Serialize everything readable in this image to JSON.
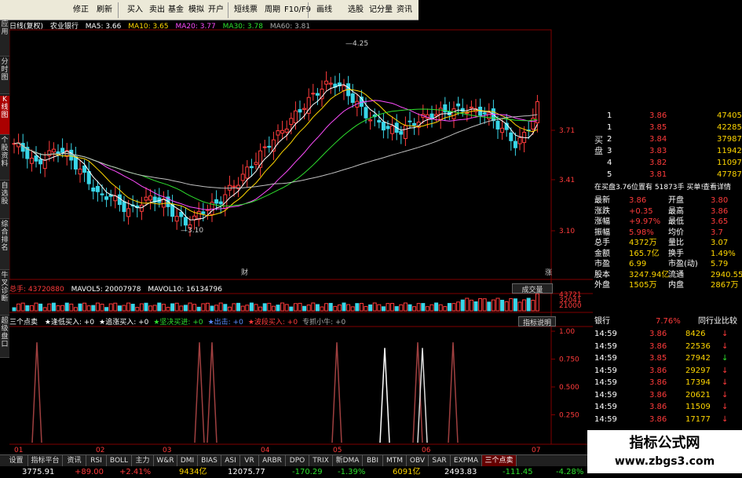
{
  "toolbar": {
    "items": [
      "修正",
      "刷新",
      "买入",
      "卖出",
      "基金",
      "模拟",
      "开户",
      "短线票",
      "周期",
      "F10/F9",
      "画线",
      "选股",
      "记分量",
      "资讯"
    ]
  },
  "left_tabs": [
    "应用",
    "分时图",
    "K线图",
    "个股资料",
    "自选股",
    "综合排名",
    "牛叉诊断",
    "超级盘口"
  ],
  "chart_legend": {
    "period": "日线(复权)",
    "stock": "农业银行",
    "ma5": "MA5: 3.66",
    "ma10": "MA10: 3.65",
    "ma20": "MA20: 3.77",
    "ma30": "MA30: 3.78",
    "ma60": "MA60: 3.81"
  },
  "volume_legend": {
    "total": "总手: 43720880",
    "mavol5": "MAVOL5: 20007978",
    "mavol10": "MAVOL10: 16134796",
    "button": "成交量"
  },
  "indicator_legend": {
    "name": "三个点卖",
    "items": [
      "★逢低买入: +0",
      "★追涨买入: +0",
      "★坚决买进: +0",
      "★出击: +0",
      "★波段买入: +0",
      "专抓小牛: +0"
    ],
    "button": "指标说明"
  },
  "annotations": {
    "high": "4.25",
    "low": "3.10",
    "cai": "财",
    "zhang": "涨"
  },
  "price_axis": [
    "3.71",
    "3.41",
    "3.10"
  ],
  "volume_axis": [
    "43721",
    "32041",
    "21000"
  ],
  "indicator_axis": [
    "1.00",
    "0.750",
    "0.500",
    "0.250"
  ],
  "x_axis": [
    "01",
    "02",
    "03",
    "04",
    "05",
    "06",
    "07"
  ],
  "orderbook": {
    "sell": [
      {
        "lv": "1",
        "price": "3.86",
        "vol": "47405"
      },
      {
        "lv": "1",
        "price": "3.85",
        "vol": "42285"
      },
      {
        "lv": "2",
        "price": "3.84",
        "vol": "37987"
      },
      {
        "lv": "3",
        "price": "3.83",
        "vol": "11942"
      },
      {
        "lv": "4",
        "price": "3.82",
        "vol": "11097"
      },
      {
        "lv": "5",
        "price": "3.81",
        "vol": "47787"
      }
    ],
    "buy_label": "买盘",
    "info": "在买盘3.76位置有 51873手 买单!",
    "info_link": "查看详情"
  },
  "quote": [
    [
      "最新",
      "3.86",
      "开盘",
      "3.80"
    ],
    [
      "涨跌",
      "+0.35",
      "最高",
      "3.86"
    ],
    [
      "涨幅",
      "+9.97%",
      "最低",
      "3.65"
    ],
    [
      "振幅",
      "5.98%",
      "均价",
      "3.7"
    ],
    [
      "总手",
      "4372万",
      "量比",
      "3.07"
    ],
    [
      "金额",
      "165.7亿",
      "换手",
      "1.49%"
    ],
    [
      "市盈",
      "6.99",
      "市盈(动)",
      "5.79"
    ],
    [
      "股本",
      "3247.94亿",
      "流通",
      "2940.55亿"
    ],
    [
      "外盘",
      "1505万",
      "内盘",
      "2867万"
    ]
  ],
  "sector": {
    "name": "银行",
    "pct": "7.76%",
    "link": "同行业比较"
  },
  "ticks": [
    [
      "14:59",
      "3.86",
      "8426",
      "↓"
    ],
    [
      "14:59",
      "3.86",
      "22536",
      "↓"
    ],
    [
      "14:59",
      "3.85",
      "27942",
      "↓"
    ],
    [
      "14:59",
      "3.86",
      "29297",
      "↓"
    ],
    [
      "14:59",
      "3.86",
      "17394",
      "↓"
    ],
    [
      "14:59",
      "3.86",
      "20621",
      "↓"
    ],
    [
      "14:59",
      "3.86",
      "11509",
      "↓"
    ],
    [
      "14:59",
      "3.86",
      "17177",
      "↓"
    ]
  ],
  "bottom_tabs": [
    "设置",
    "指标平台",
    "资讯",
    "RSI",
    "BOLL",
    "主力",
    "W&R",
    "DMI",
    "BIAS",
    "ASI",
    "VR",
    "ARBR",
    "DPO",
    "TRIX",
    "新DMA",
    "BBI",
    "MTM",
    "OBV",
    "SAR",
    "EXPMA",
    "三个点卖"
  ],
  "status": [
    "3775.91",
    "+89.00",
    "+2.41%",
    "9434亿",
    "12075.77",
    "-170.29",
    "-1.39%",
    "6091亿",
    "2493.83",
    "-111.45",
    "-4.28%"
  ],
  "watermark": {
    "title": "指标公式网",
    "url": "www.zbgs3.com"
  },
  "colors": {
    "up": "#ff3b3b",
    "down": "#2ee02e",
    "ma5": "#ffffff",
    "ma10": "#ffd700",
    "ma20": "#ff4dff",
    "ma30": "#2ee02e",
    "ma60": "#c0c0c0",
    "bg": "#000000"
  }
}
